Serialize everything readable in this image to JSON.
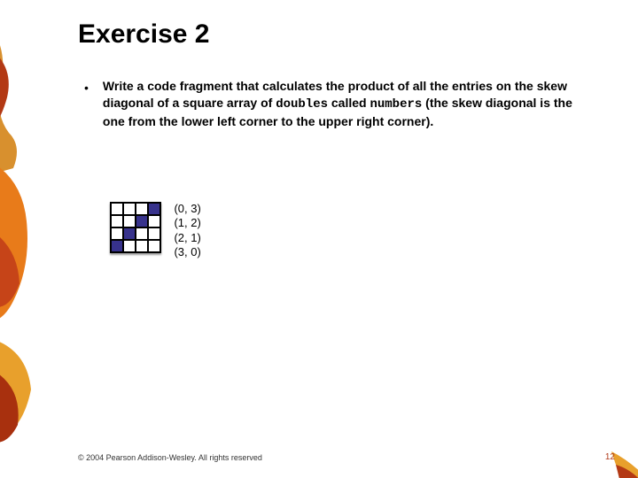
{
  "title": "Exercise 2",
  "bullet": {
    "dot": "•",
    "text_before": "Write a code fragment that calculates the product of all the entries on the skew diagonal of a square array of ",
    "code1": "doubles",
    "text_mid": " called ",
    "code2": "numbers",
    "text_after": " (the skew diagonal is the one from the lower left corner to the upper right corner)."
  },
  "grid": {
    "rows": [
      [
        "0",
        "0",
        "0",
        "1"
      ],
      [
        "0",
        "0",
        "1",
        "0"
      ],
      [
        "0",
        "1",
        "0",
        "0"
      ],
      [
        "1",
        "0",
        "0",
        "0"
      ]
    ]
  },
  "coords": [
    "(0, 3)",
    "(1, 2)",
    "(2, 1)",
    "(3, 0)"
  ],
  "footer": "© 2004 Pearson Addison-Wesley. All rights reserved",
  "page": "12"
}
